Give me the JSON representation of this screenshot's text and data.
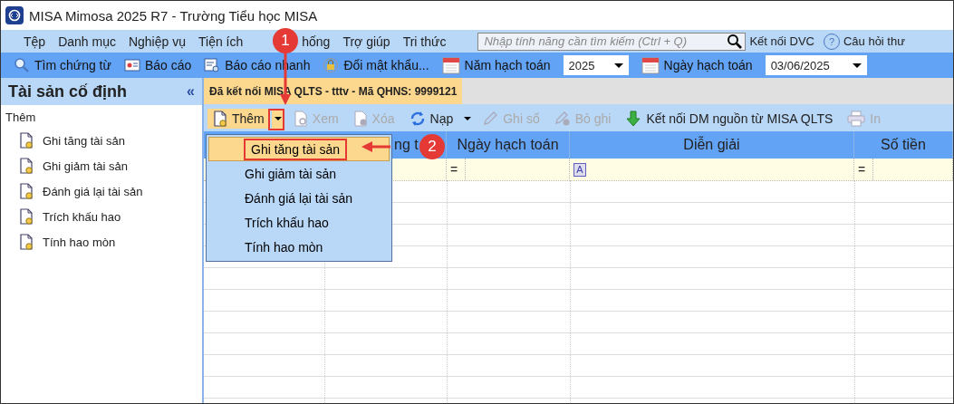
{
  "window": {
    "title": "MISA Mimosa 2025 R7 - Trường Tiểu học MISA"
  },
  "menu": [
    {
      "label": "Tệp",
      "kind": "plain"
    },
    {
      "label": "Danh mục",
      "kind": "plain"
    },
    {
      "label": "Nghiệp vụ",
      "kind": "plain"
    },
    {
      "label": "Tiện ích",
      "kind": "plain"
    },
    {
      "label": "hống",
      "kind": "covered"
    },
    {
      "label": "Trợ giúp",
      "kind": "plain"
    },
    {
      "label": "Tri thức",
      "kind": "plain"
    }
  ],
  "search": {
    "placeholder": "Nhập tính năng cần tìm kiếm (Ctrl + Q)"
  },
  "top_links": [
    {
      "label": "Kết nối DVC",
      "kind": "plain"
    },
    {
      "label": "Câu hỏi thư",
      "kind": "help",
      "icon": "?"
    }
  ],
  "toolbar": [
    {
      "label": "Tìm chứng từ",
      "kind": "search"
    },
    {
      "label": "Báo cáo",
      "kind": "report"
    },
    {
      "label": "Báo cáo nhanh",
      "kind": "quick"
    },
    {
      "label": "Đổi mật khẩu...",
      "kind": "lock"
    }
  ],
  "year": {
    "label": "Năm hạch toán",
    "value": "2025"
  },
  "date": {
    "label": "Ngày hạch toán",
    "value": "03/06/2025"
  },
  "sidebar": {
    "title": "Tài sản cố định",
    "collapse": "«",
    "section": "Thêm",
    "items": [
      "Ghi tăng tài sản",
      "Ghi giảm tài sản",
      "Đánh giá lại tài sản",
      "Trích khấu hao",
      "Tính hao mòn"
    ]
  },
  "tab": {
    "label": "Đã kết nối MISA QLTS - tttv - Mã QHNS: 9999121",
    "selected": true
  },
  "actions": [
    {
      "label": "Thêm",
      "kind": "doc",
      "disabled": false,
      "dropdown": true
    },
    {
      "label": "Xem",
      "kind": "view",
      "disabled": true,
      "dropdown": false
    },
    {
      "label": "Xóa",
      "kind": "delete",
      "disabled": true,
      "dropdown": false
    },
    {
      "label": "Nạp",
      "kind": "reload",
      "disabled": false,
      "dropdown": true
    },
    {
      "label": "Ghi sổ",
      "kind": "pen",
      "disabled": true,
      "dropdown": false
    },
    {
      "label": "Bỏ ghi",
      "kind": "unpen",
      "disabled": true,
      "dropdown": false
    },
    {
      "label": "Kết nối DM nguồn từ MISA QLTS",
      "kind": "down",
      "disabled": false,
      "dropdown": false
    },
    {
      "label": "In",
      "kind": "print",
      "disabled": true,
      "dropdown": false
    }
  ],
  "table": {
    "columns": [
      {
        "label": "ng t"
      },
      {
        "label": "Ngày hạch toán",
        "filter": "=",
        "kind": "operator"
      },
      {
        "label": "Diễn giải",
        "filter": "A",
        "kind": "text"
      },
      {
        "label": "Số tiền",
        "filter": "=",
        "kind": "operator"
      }
    ]
  },
  "dropdown_menu": [
    {
      "label": "Ghi tăng tài sản",
      "selected": true
    },
    {
      "label": "Ghi giảm tài sản",
      "selected": false
    },
    {
      "label": "Đánh giá lại tài sản",
      "selected": false
    },
    {
      "label": "Trích khấu hao",
      "selected": false
    },
    {
      "label": "Tính hao mòn",
      "selected": false
    }
  ],
  "annotations": [
    {
      "label": "1"
    },
    {
      "label": "2"
    }
  ]
}
